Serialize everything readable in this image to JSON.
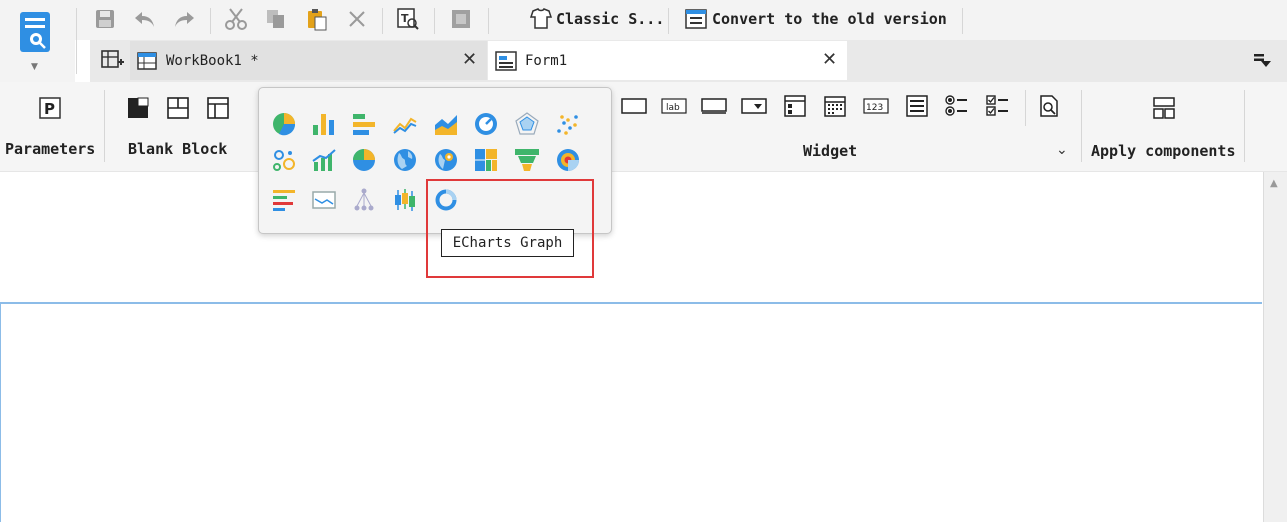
{
  "toolbar": {
    "classic_style_label": "Classic S...",
    "convert_label": "Convert to the old version"
  },
  "tabs": [
    {
      "label": "WorkBook1 *",
      "active": false
    },
    {
      "label": "Form1",
      "active": true
    }
  ],
  "ribbon": {
    "parameters_label": "Parameters",
    "blank_block_label": "Blank Block",
    "widget_label": "Widget",
    "apply_components_label": "Apply components",
    "widget_icons": [
      "button-icon",
      "label-widget-icon",
      "text-field-icon",
      "combo-box-icon",
      "tree-combo-icon",
      "date-picker-icon",
      "number-field-icon",
      "list-view-icon",
      "radio-group-icon",
      "checkbox-group-icon",
      "query-icon"
    ]
  },
  "chart_popup": {
    "icons": [
      "pie-chart-icon",
      "bar-chart-icon",
      "horizontal-bar-icon",
      "line-chart-icon",
      "area-chart-icon",
      "gauge-chart-icon",
      "radar-chart-icon",
      "scatter-chart-icon",
      "bubble-chart-icon",
      "combo-chart-icon",
      "donut-chart-icon",
      "map-chart-icon",
      "point-map-icon",
      "treemap-chart-icon",
      "funnel-chart-icon",
      "multi-pie-icon",
      "gantt-chart-icon",
      "frame-chart-icon",
      "structure-chart-icon",
      "box-plot-icon",
      "echarts-graph-icon"
    ],
    "tooltip": "ECharts Graph"
  },
  "colors": {
    "accent_blue": "#2f8fe3",
    "highlight_red": "#e0393a",
    "chart_green": "#3fb56b",
    "chart_yellow": "#f3b52a",
    "canvas_border": "#8cbce8"
  }
}
